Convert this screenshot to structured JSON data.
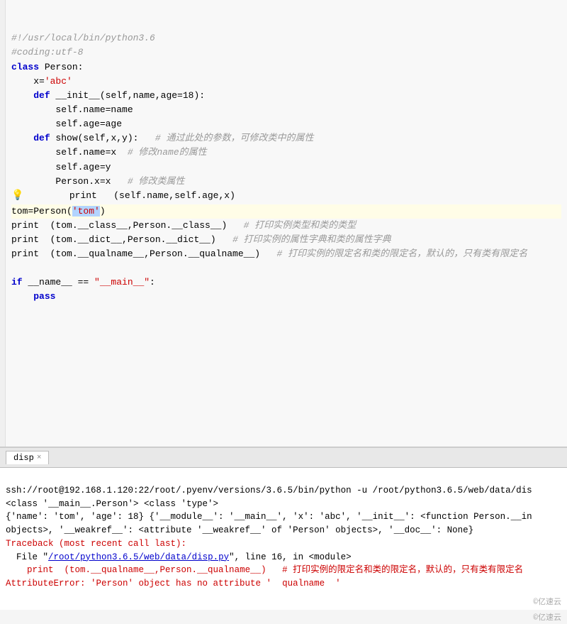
{
  "editor": {
    "lines": [
      {
        "num": "",
        "content": "#!/usr/local/bin/python3.6",
        "type": "comment",
        "highlighted": false
      },
      {
        "num": "",
        "content": "#coding:utf-8",
        "type": "comment",
        "highlighted": false
      },
      {
        "num": "",
        "content": "class Person:",
        "type": "code",
        "highlighted": false
      },
      {
        "num": "",
        "content": "    x='abc'",
        "type": "code",
        "highlighted": false
      },
      {
        "num": "",
        "content": "    def __init__(self,name,age=18):",
        "type": "code",
        "highlighted": false
      },
      {
        "num": "",
        "content": "        self.name=name",
        "type": "code",
        "highlighted": false
      },
      {
        "num": "",
        "content": "        self.age=age",
        "type": "code",
        "highlighted": false
      },
      {
        "num": "",
        "content": "    def show(self,x,y):   # 通过此处的参数，可修改类中的属性",
        "type": "code",
        "highlighted": false
      },
      {
        "num": "",
        "content": "        self.name=x  # 修改name的属性",
        "type": "code",
        "highlighted": false
      },
      {
        "num": "",
        "content": "        self.age=y",
        "type": "code",
        "highlighted": false
      },
      {
        "num": "",
        "content": "        Person.x=x   # 修改类属性",
        "type": "code",
        "highlighted": false
      },
      {
        "num": "",
        "content": "        print   (self.name,self.age,x)",
        "type": "code",
        "highlighted": false,
        "lightbulb": true
      },
      {
        "num": "",
        "content": "tom=Person('tom')",
        "type": "code",
        "highlighted": true
      },
      {
        "num": "",
        "content": "print  (tom.__class__,Person.__class__)   # 打印实例类型和类的类型",
        "type": "code",
        "highlighted": false
      },
      {
        "num": "",
        "content": "print  (tom.__dict__,Person.__dict__)   # 打印实例的属性字典和类的属性字典",
        "type": "code",
        "highlighted": false
      },
      {
        "num": "",
        "content": "print  (tom.__qualname__,Person.__qualname__)   # 打印实例的限定名和类的限定名，默认的，只有类有限定名",
        "type": "code",
        "highlighted": false
      },
      {
        "num": "",
        "content": "",
        "type": "code",
        "highlighted": false
      },
      {
        "num": "",
        "content": "if __name__ == \"__main__\":",
        "type": "code",
        "highlighted": false
      },
      {
        "num": "",
        "content": "    pass",
        "type": "code",
        "highlighted": false
      }
    ]
  },
  "terminal": {
    "tab_label": "disp",
    "tab_close": "×",
    "lines": [
      "ssh://root@192.168.1.120:22/root/.pyenv/versions/3.6.5/bin/python -u /root/python3.6.5/web/data/dis",
      "<class '__main__.Person'> <class 'type'>",
      "{'name': 'tom', 'age': 18} {'__module__': '__main__', 'x': 'abc', '__init__': <function Person.__in",
      "objects>, '__weakref__': <attribute '__weakref__' of 'Person' objects>, '__doc__': None}",
      "Traceback (most recent call last):",
      "  File \"/root/python3.6.5/web/data/disp.py\", line 16, in <module>",
      "    print  (tom.__qualname__,Person.__qualname__)   # 打印实例的限定名和类的限定名，默认的，只有类有限定名",
      "AttributeError: 'Person' object has no attribute '  qualname  '"
    ],
    "link_line_index": 5,
    "link_text": "/root/python3.6.5/web/data/disp.py",
    "watermark": "©亿速云"
  }
}
